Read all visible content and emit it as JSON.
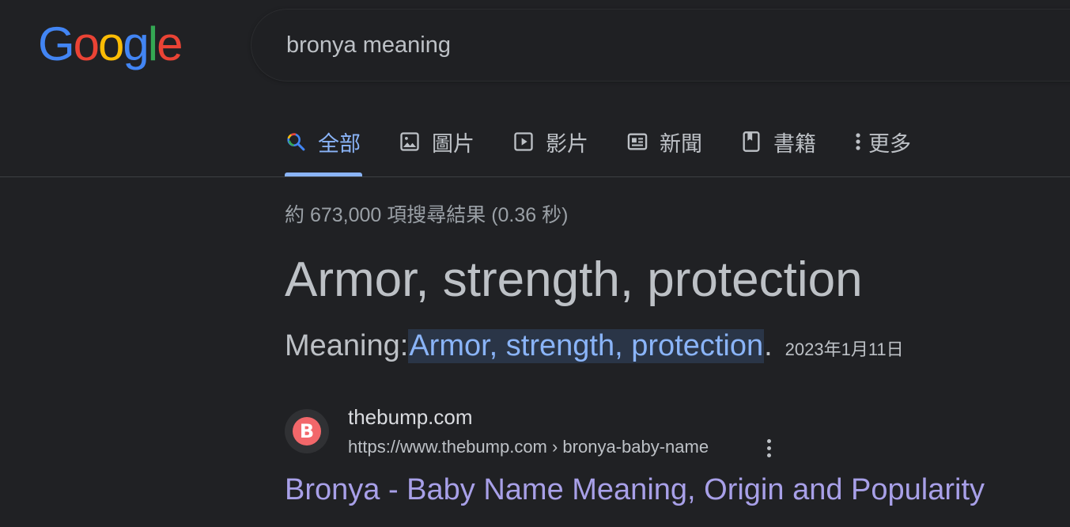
{
  "logo": {
    "letters": [
      "G",
      "o",
      "o",
      "g",
      "l",
      "e"
    ],
    "alt": "Google"
  },
  "search": {
    "query": "bronya meaning"
  },
  "tabs": [
    {
      "label": "全部",
      "icon": "search-icon",
      "active": true
    },
    {
      "label": "圖片",
      "icon": "image-icon",
      "active": false
    },
    {
      "label": "影片",
      "icon": "video-icon",
      "active": false
    },
    {
      "label": "新聞",
      "icon": "news-icon",
      "active": false
    },
    {
      "label": "書籍",
      "icon": "book-icon",
      "active": false
    },
    {
      "label": "更多",
      "icon": "more-vert-icon",
      "active": false
    }
  ],
  "result_stats": "約 673,000 項搜尋結果 (0.36 秒)",
  "featured_snippet": {
    "answer": "Armor, strength, protection",
    "meaning_prefix": "Meaning:",
    "meaning_highlight": "Armor, strength, protection",
    "meaning_suffix": ".",
    "date": "2023年1月11日"
  },
  "source": {
    "favicon_letter": "B",
    "site_name": "thebump.com",
    "url": "https://www.thebump.com › bronya-baby-name",
    "title": "Bronya - Baby Name Meaning, Origin and Popularity"
  },
  "colors": {
    "background": "#202124",
    "accent": "#8ab4f8",
    "link_visited": "#a8a0e8",
    "favicon": "#f2676a"
  }
}
